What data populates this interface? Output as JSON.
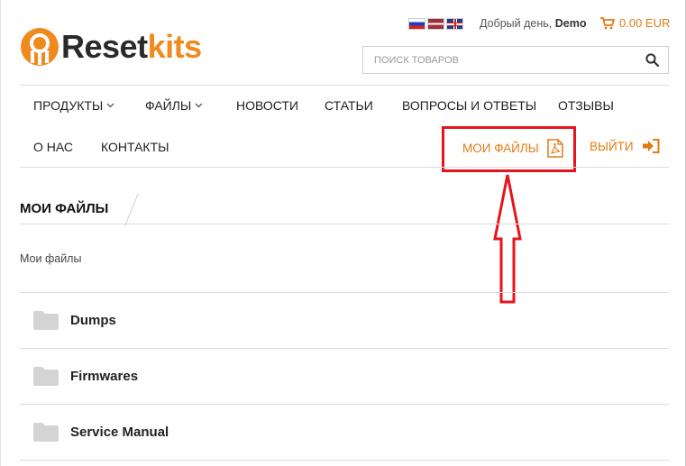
{
  "topbar": {
    "flags": [
      "ru",
      "lv",
      "gb"
    ],
    "greeting_prefix": "Добрый день,",
    "user_name": "Demo",
    "cart_total": "0.00 EUR"
  },
  "logo": {
    "part1": "Reset",
    "part2": "kits"
  },
  "search": {
    "placeholder": "ПОИСК ТОВАРОВ",
    "value": ""
  },
  "nav": {
    "products": "ПРОДУКТЫ",
    "files": "ФАЙЛЫ",
    "news": "НОВОСТИ",
    "articles": "СТАТЬИ",
    "faq": "ВОПРОСЫ И ОТВЕТЫ",
    "reviews": "ОТЗЫВЫ",
    "about": "О НАС",
    "contacts": "КОНТАКТЫ",
    "my_files": "МОИ ФАЙЛЫ",
    "logout": "ВЫЙТИ"
  },
  "page": {
    "title": "МОИ ФАЙЛЫ",
    "breadcrumb": "Мои файлы"
  },
  "folders": [
    {
      "label": "Dumps"
    },
    {
      "label": "Firmwares"
    },
    {
      "label": "Service Manual"
    }
  ],
  "colors": {
    "accent": "#e07b12",
    "annotation": "#e8141c"
  }
}
